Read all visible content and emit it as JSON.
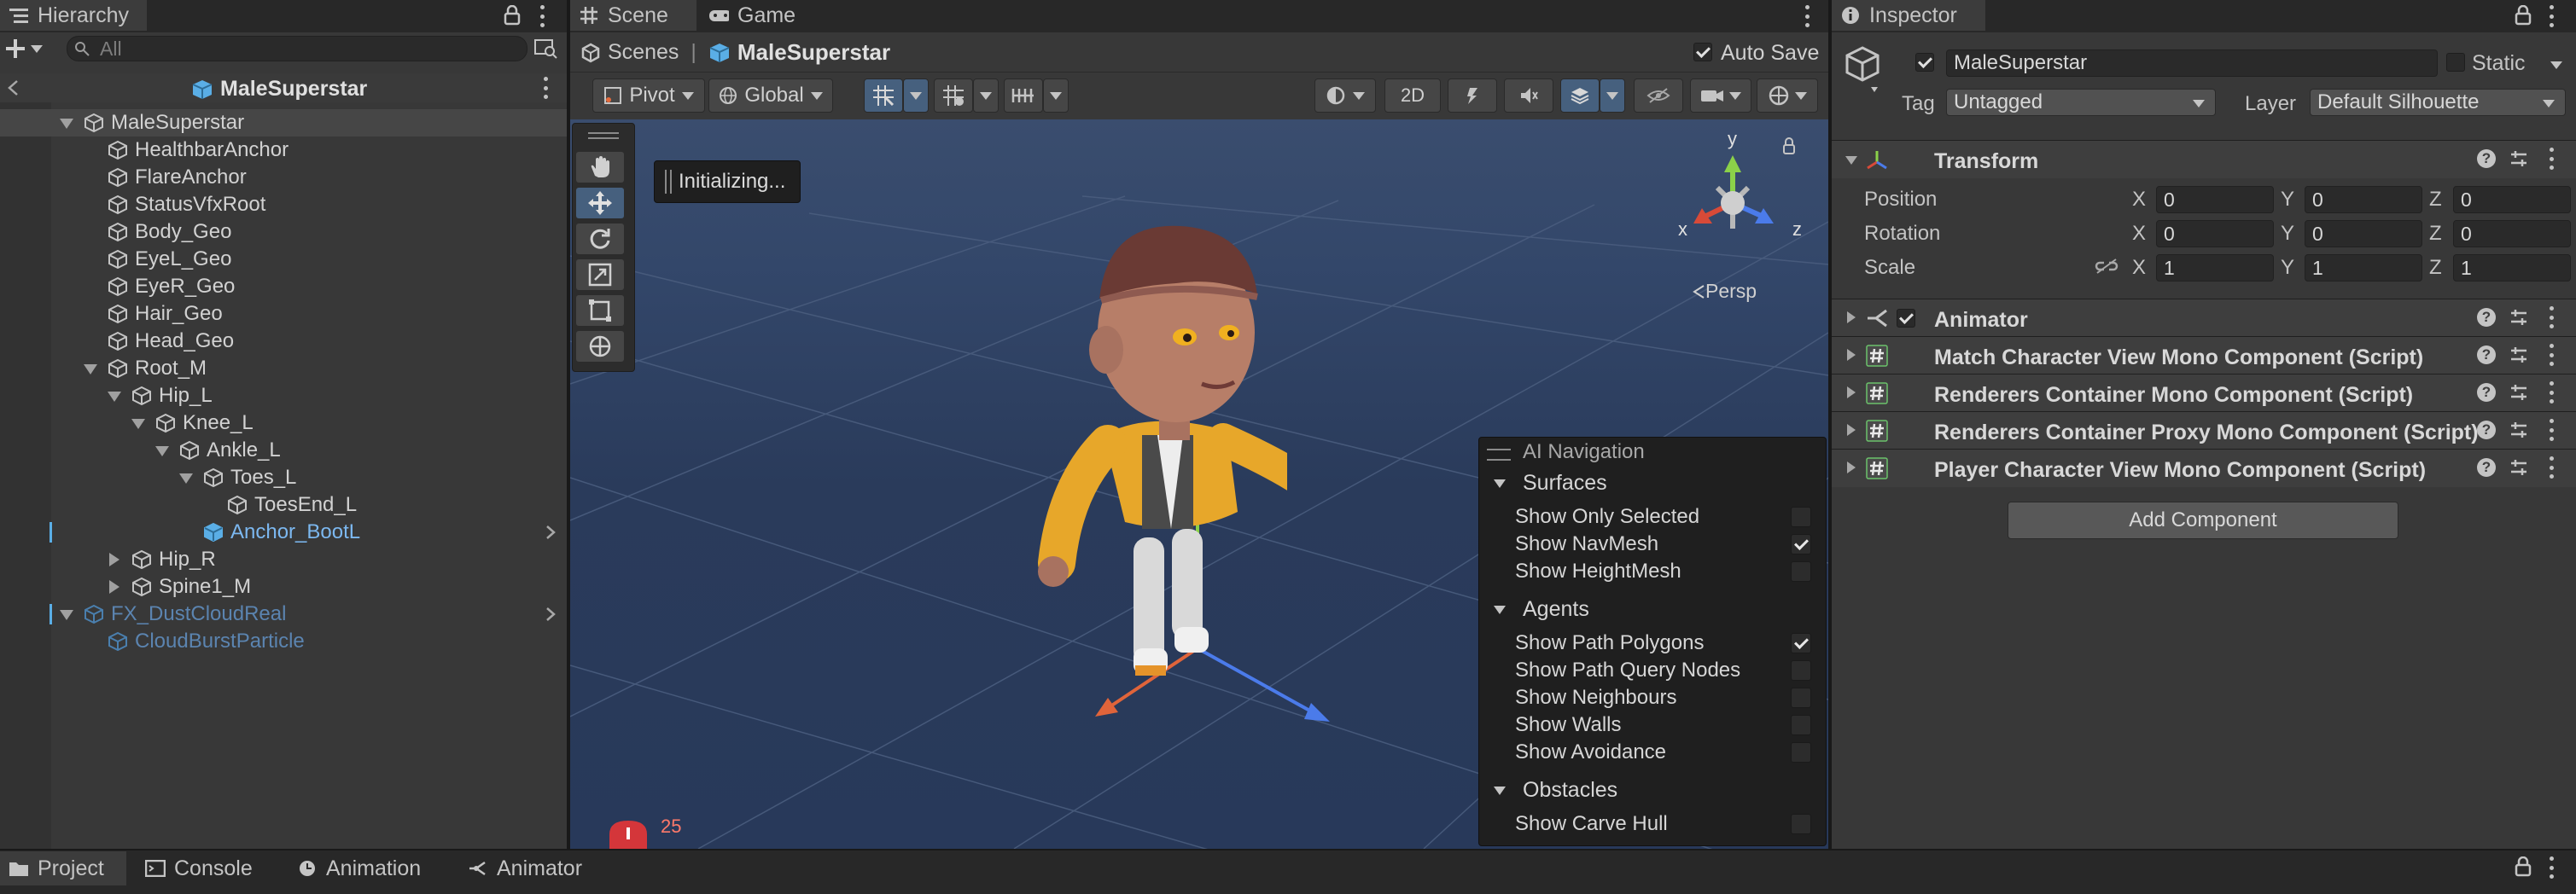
{
  "hierarchy": {
    "tab_label": "Hierarchy",
    "search_placeholder": "All",
    "scene_title": "MaleSuperstar",
    "rows": [
      {
        "label": "MaleSuperstar",
        "depth": 0,
        "arrow": "down",
        "style": "root"
      },
      {
        "label": "HealthbarAnchor",
        "depth": 1,
        "arrow": "none",
        "style": "normal"
      },
      {
        "label": "FlareAnchor",
        "depth": 1,
        "arrow": "none",
        "style": "normal"
      },
      {
        "label": "StatusVfxRoot",
        "depth": 1,
        "arrow": "none",
        "style": "normal"
      },
      {
        "label": "Body_Geo",
        "depth": 1,
        "arrow": "none",
        "style": "normal"
      },
      {
        "label": "EyeL_Geo",
        "depth": 1,
        "arrow": "none",
        "style": "normal"
      },
      {
        "label": "EyeR_Geo",
        "depth": 1,
        "arrow": "none",
        "style": "normal"
      },
      {
        "label": "Hair_Geo",
        "depth": 1,
        "arrow": "none",
        "style": "normal"
      },
      {
        "label": "Head_Geo",
        "depth": 1,
        "arrow": "none",
        "style": "normal"
      },
      {
        "label": "Root_M",
        "depth": 1,
        "arrow": "down",
        "style": "normal"
      },
      {
        "label": "Hip_L",
        "depth": 2,
        "arrow": "down",
        "style": "normal"
      },
      {
        "label": "Knee_L",
        "depth": 3,
        "arrow": "down",
        "style": "normal"
      },
      {
        "label": "Ankle_L",
        "depth": 4,
        "arrow": "down",
        "style": "normal"
      },
      {
        "label": "Toes_L",
        "depth": 5,
        "arrow": "down",
        "style": "normal"
      },
      {
        "label": "ToesEnd_L",
        "depth": 6,
        "arrow": "none",
        "style": "normal"
      },
      {
        "label": "Anchor_BootL",
        "depth": 5,
        "arrow": "none",
        "style": "prefab"
      },
      {
        "label": "Hip_R",
        "depth": 2,
        "arrow": "right",
        "style": "normal"
      },
      {
        "label": "Spine1_M",
        "depth": 2,
        "arrow": "right",
        "style": "normal"
      },
      {
        "label": "FX_DustCloudReal",
        "depth": 0,
        "arrow": "down",
        "style": "prefab-dim"
      },
      {
        "label": "CloudBurstParticle",
        "depth": 1,
        "arrow": "none",
        "style": "prefab-dim"
      }
    ]
  },
  "scene": {
    "tabs": [
      "Scene",
      "Game"
    ],
    "breadcrumb_root": "Scenes",
    "breadcrumb_current": "MaleSuperstar",
    "auto_save_label": "Auto Save",
    "auto_save_checked": true,
    "pivot_label": "Pivot",
    "global_label": "Global",
    "mode_2d_label": "2D",
    "initializing_text": "Initializing...",
    "persp_label": "Persp",
    "gizmo_axes": [
      "y",
      "x",
      "z"
    ],
    "badge_count": "25"
  },
  "ai_navigation": {
    "title": "AI Navigation",
    "sections": [
      {
        "heading": "Surfaces",
        "items": [
          {
            "label": "Show Only Selected",
            "checked": false
          },
          {
            "label": "Show NavMesh",
            "checked": true
          },
          {
            "label": "Show HeightMesh",
            "checked": false
          }
        ]
      },
      {
        "heading": "Agents",
        "items": [
          {
            "label": "Show Path Polygons",
            "checked": true
          },
          {
            "label": "Show Path Query Nodes",
            "checked": false
          },
          {
            "label": "Show Neighbours",
            "checked": false
          },
          {
            "label": "Show Walls",
            "checked": false
          },
          {
            "label": "Show Avoidance",
            "checked": false
          }
        ]
      },
      {
        "heading": "Obstacles",
        "items": [
          {
            "label": "Show Carve Hull",
            "checked": false
          }
        ]
      }
    ]
  },
  "inspector": {
    "tab_label": "Inspector",
    "object_name": "MaleSuperstar",
    "object_enabled": true,
    "static_label": "Static",
    "tag_label": "Tag",
    "tag_value": "Untagged",
    "layer_label": "Layer",
    "layer_value": "Default Silhouette",
    "transform": {
      "title": "Transform",
      "rows": [
        {
          "label": "Position",
          "x": "0",
          "y": "0",
          "z": "0"
        },
        {
          "label": "Rotation",
          "x": "0",
          "y": "0",
          "z": "0"
        },
        {
          "label": "Scale",
          "x": "1",
          "y": "1",
          "z": "1"
        }
      ],
      "axis_x": "X",
      "axis_y": "Y",
      "axis_z": "Z"
    },
    "components": [
      {
        "title": "Animator",
        "kind": "animator",
        "enabled": true
      },
      {
        "title": "Match Character View Mono Component (Script)",
        "kind": "script"
      },
      {
        "title": "Renderers Container Mono Component (Script)",
        "kind": "script"
      },
      {
        "title": "Renderers Container Proxy Mono Component (Script)",
        "kind": "script"
      },
      {
        "title": "Player Character View Mono Component (Script)",
        "kind": "script"
      }
    ],
    "add_component_label": "Add Component"
  },
  "bottom_tabs": [
    "Project",
    "Console",
    "Animation",
    "Animator"
  ]
}
